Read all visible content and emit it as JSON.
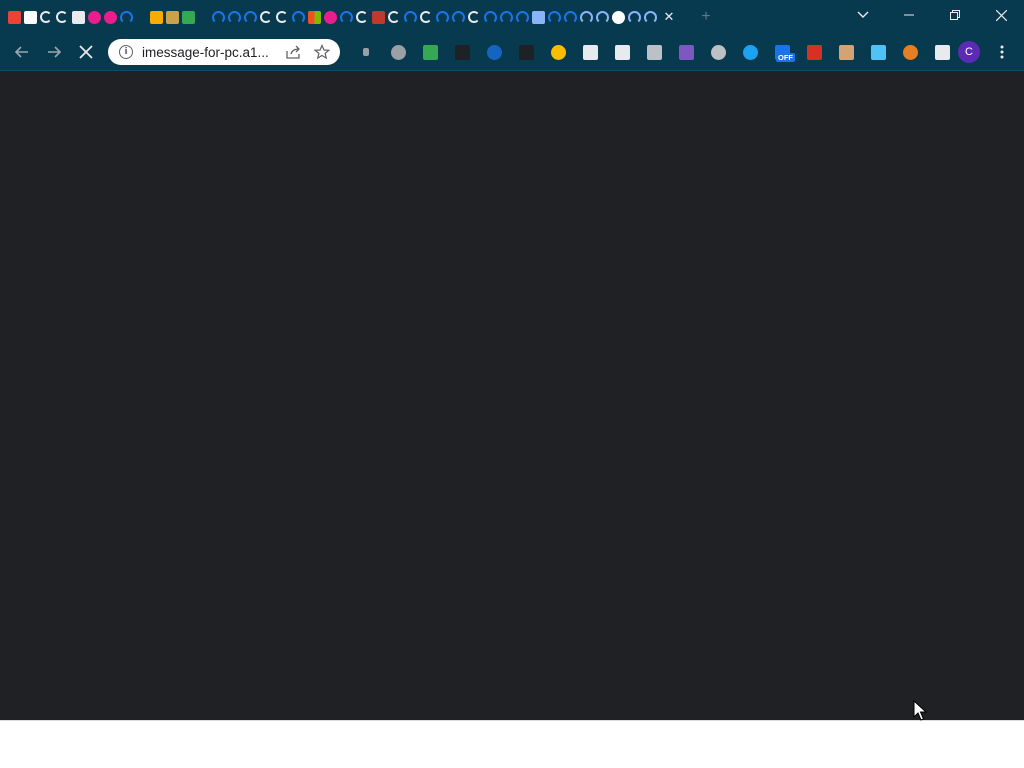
{
  "browser": {
    "tabs": [
      {
        "icon": "gmail-icon",
        "color": "#ea4335"
      },
      {
        "icon": "doc-icon",
        "color": "#ffffff"
      },
      {
        "icon": "c-icon",
        "color": "#e8eaed"
      },
      {
        "icon": "c-icon",
        "color": "#e8eaed"
      },
      {
        "icon": "page-icon",
        "color": "#e8eaed"
      },
      {
        "icon": "s-icon",
        "color": "#e91e8c"
      },
      {
        "icon": "s-icon",
        "color": "#e91e8c"
      },
      {
        "icon": "loading-icon",
        "color": "#1a73e8"
      },
      {
        "icon": "gap",
        "color": ""
      },
      {
        "icon": "tool-icon",
        "color": "#f9ab00"
      },
      {
        "icon": "book-icon",
        "color": "#c9a24a"
      },
      {
        "icon": "android-icon",
        "color": "#34a853"
      },
      {
        "icon": "gap",
        "color": ""
      },
      {
        "icon": "loading-icon",
        "color": "#1a73e8"
      },
      {
        "icon": "loading-icon",
        "color": "#1a73e8"
      },
      {
        "icon": "loading-icon",
        "color": "#1a73e8"
      },
      {
        "icon": "c-icon",
        "color": "#e8eaed"
      },
      {
        "icon": "c-icon",
        "color": "#e8eaed"
      },
      {
        "icon": "loading-icon",
        "color": "#1a73e8"
      },
      {
        "icon": "microsoft-icon",
        "color": "#f25022"
      },
      {
        "icon": "s-icon",
        "color": "#e91e8c"
      },
      {
        "icon": "loading-icon",
        "color": "#1a73e8"
      },
      {
        "icon": "c-icon",
        "color": "#e8eaed"
      },
      {
        "icon": "photo-icon",
        "color": "#c0392b"
      },
      {
        "icon": "c-icon",
        "color": "#e8eaed"
      },
      {
        "icon": "loading-icon",
        "color": "#1a73e8"
      },
      {
        "icon": "c-icon",
        "color": "#e8eaed"
      },
      {
        "icon": "loading-icon",
        "color": "#1a73e8"
      },
      {
        "icon": "loading-icon",
        "color": "#1a73e8"
      },
      {
        "icon": "c-icon",
        "color": "#e8eaed"
      },
      {
        "icon": "loading-icon",
        "color": "#1a73e8"
      },
      {
        "icon": "loading-icon",
        "color": "#1a73e8"
      },
      {
        "icon": "loading-icon",
        "color": "#1a73e8"
      },
      {
        "icon": "notepad-icon",
        "color": "#8ab4f8"
      },
      {
        "icon": "loading-icon",
        "color": "#1a73e8"
      },
      {
        "icon": "loading-icon",
        "color": "#1a73e8"
      },
      {
        "icon": "loading-icon",
        "color": "#8ab4f8"
      },
      {
        "icon": "loading-icon",
        "color": "#8ab4f8"
      },
      {
        "icon": "ghost-icon",
        "color": "#ffffff"
      },
      {
        "icon": "loading-icon",
        "color": "#8ab4f8"
      },
      {
        "icon": "loading-icon",
        "color": "#8ab4f8"
      }
    ],
    "tab_close_label": "✕",
    "new_tab_label": "+",
    "url": "imessage-for-pc.a1...",
    "extensions": [
      {
        "icon": "speaker-icon",
        "color": "#9aa0a6"
      },
      {
        "icon": "drive-icon",
        "color": "#9aa0a6"
      },
      {
        "icon": "chat-icon",
        "color": "#34a853"
      },
      {
        "icon": "rss-icon",
        "color": "#202124"
      },
      {
        "icon": "vpn-icon",
        "color": "#1565c0"
      },
      {
        "icon": "hammer-icon",
        "color": "#202124"
      },
      {
        "icon": "smiley-icon",
        "color": "#fbbc04"
      },
      {
        "icon": "image-icon",
        "color": "#e8eaed"
      },
      {
        "icon": "cross-arrows-icon",
        "color": "#e8eaed"
      },
      {
        "icon": "h-icon",
        "color": "#bdc1c6"
      },
      {
        "icon": "r-icon",
        "color": "#7e57c2"
      },
      {
        "icon": "cloud-icon",
        "color": "#bdc1c6"
      },
      {
        "icon": "edge-icon",
        "color": "#1da1f2"
      },
      {
        "icon": "coupon-icon",
        "color": "#1a73e8",
        "badge": "OFF"
      },
      {
        "icon": "card-icon",
        "color": "#d93025"
      },
      {
        "icon": "cat-icon",
        "color": "#d4a373"
      },
      {
        "icon": "play-icon",
        "color": "#4fc3f7"
      },
      {
        "icon": "monkey-icon",
        "color": "#e67e22"
      },
      {
        "icon": "puzzle-icon",
        "color": "#e8eaed"
      }
    ],
    "profile_initial": "C",
    "theme_colors": {
      "frame": "#083a4f",
      "page": "#202124"
    }
  }
}
